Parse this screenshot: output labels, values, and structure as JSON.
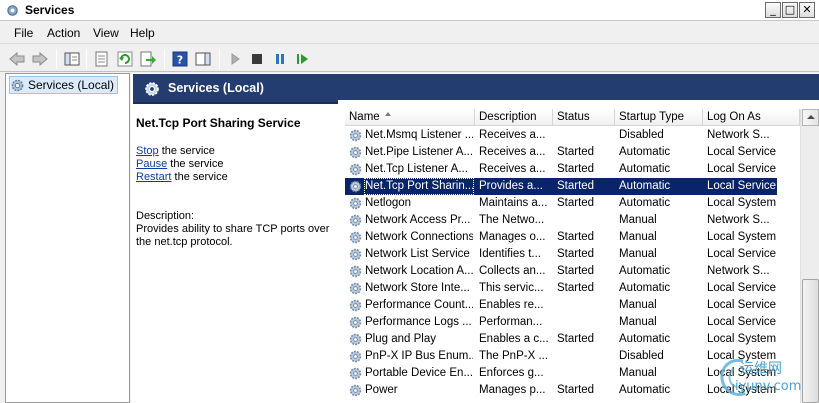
{
  "window": {
    "title": "Services",
    "min_glyph": "_",
    "max_glyph": "□",
    "close_glyph": "✕"
  },
  "menu": [
    "File",
    "Action",
    "View",
    "Help"
  ],
  "toolbar": {
    "icons": [
      "back-arrow-icon",
      "forward-arrow-icon",
      "show-hide-console-tree-icon",
      "properties-icon",
      "refresh-icon",
      "export-list-icon",
      "help-icon",
      "action-pane-icon",
      "start-service-icon",
      "stop-service-icon",
      "pause-service-icon",
      "restart-service-icon"
    ]
  },
  "tree": {
    "selected_label": "Services (Local)"
  },
  "pane": {
    "title": "Services (Local)",
    "detail": {
      "service_name": "Net.Tcp Port Sharing Service",
      "actions": [
        {
          "link": "Stop",
          "suffix": " the service"
        },
        {
          "link": "Pause",
          "suffix": " the service"
        },
        {
          "link": "Restart",
          "suffix": " the service"
        }
      ],
      "description_label": "Description:",
      "description_line1": "Provides ability to share TCP ports over",
      "description_line2": "the net.tcp protocol."
    }
  },
  "grid": {
    "columns": [
      "Name",
      "Description",
      "Status",
      "Startup Type",
      "Log On As"
    ],
    "selected_index": 3,
    "rows": [
      [
        "Net.Msmq Listener ...",
        "Receives a...",
        "",
        "Disabled",
        "Network S..."
      ],
      [
        "Net.Pipe Listener A...",
        "Receives a...",
        "Started",
        "Automatic",
        "Local Service"
      ],
      [
        "Net.Tcp Listener A...",
        "Receives a...",
        "Started",
        "Automatic",
        "Local Service"
      ],
      [
        "Net.Tcp Port Sharin...",
        "Provides a...",
        "Started",
        "Automatic",
        "Local Service"
      ],
      [
        "Netlogon",
        "Maintains a...",
        "Started",
        "Automatic",
        "Local System"
      ],
      [
        "Network Access Pr...",
        "The Netwo...",
        "",
        "Manual",
        "Network S..."
      ],
      [
        "Network Connections",
        "Manages o...",
        "Started",
        "Manual",
        "Local System"
      ],
      [
        "Network List Service",
        "Identifies t...",
        "Started",
        "Manual",
        "Local Service"
      ],
      [
        "Network Location A...",
        "Collects an...",
        "Started",
        "Automatic",
        "Network S..."
      ],
      [
        "Network Store Inte...",
        "This servic...",
        "Started",
        "Automatic",
        "Local Service"
      ],
      [
        "Performance Count...",
        "Enables re...",
        "",
        "Manual",
        "Local Service"
      ],
      [
        "Performance Logs ...",
        "Performan...",
        "",
        "Manual",
        "Local Service"
      ],
      [
        "Plug and Play",
        "Enables a c...",
        "Started",
        "Automatic",
        "Local System"
      ],
      [
        "PnP-X IP Bus Enum...",
        "The PnP-X ...",
        "",
        "Disabled",
        "Local System"
      ],
      [
        "Portable Device En...",
        "Enforces g...",
        "",
        "Manual",
        "Local System"
      ],
      [
        "Power",
        "Manages p...",
        "Started",
        "Automatic",
        "Local System"
      ]
    ]
  },
  "watermark": {
    "line1": "运维网",
    "line2": "iyunv.com"
  },
  "colors": {
    "header_bg": "#233d70",
    "selection_bg": "#0a246a",
    "link": "#0b3e9c"
  }
}
